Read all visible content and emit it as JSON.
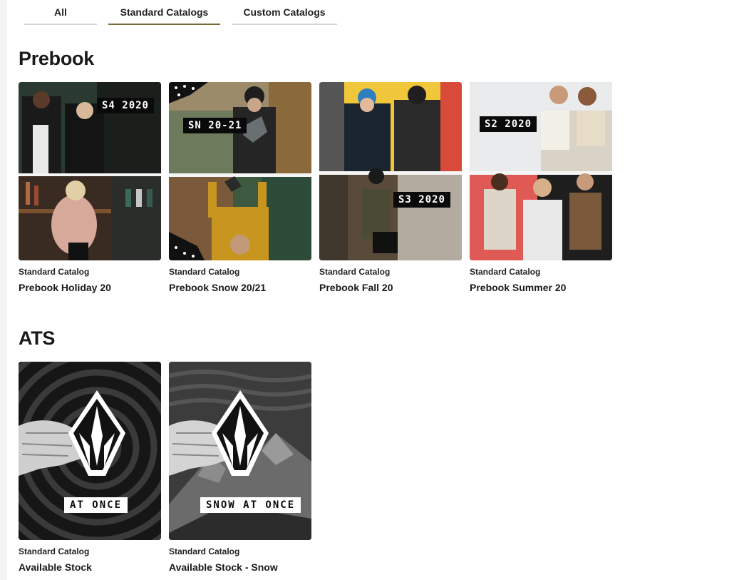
{
  "tabs": [
    {
      "label": "All",
      "active": false
    },
    {
      "label": "Standard Catalogs",
      "active": true
    },
    {
      "label": "Custom Catalogs",
      "active": false
    }
  ],
  "sections": [
    {
      "title": "Prebook",
      "cards": [
        {
          "type": "Standard Catalog",
          "name": "Prebook Holiday 20",
          "badge": "S4 2020"
        },
        {
          "type": "Standard Catalog",
          "name": "Prebook Snow 20/21",
          "badge": "SN 20-21"
        },
        {
          "type": "Standard Catalog",
          "name": "Prebook Fall 20",
          "badge": "S3 2020"
        },
        {
          "type": "Standard Catalog",
          "name": "Prebook Summer 20",
          "badge": "S2 2020"
        }
      ]
    },
    {
      "title": "ATS",
      "cards": [
        {
          "type": "Standard Catalog",
          "name": "Available Stock",
          "badge": "AT ONCE"
        },
        {
          "type": "Standard Catalog",
          "name": "Available Stock - Snow",
          "badge": "SNOW AT ONCE"
        }
      ]
    }
  ],
  "colors": {
    "active_tab_underline": "#7a6a3a",
    "inactive_tab_underline": "#d4d4d4",
    "badge_bg": "#0a0a0a"
  },
  "icons": {
    "logo": "volcom-stone-icon"
  }
}
